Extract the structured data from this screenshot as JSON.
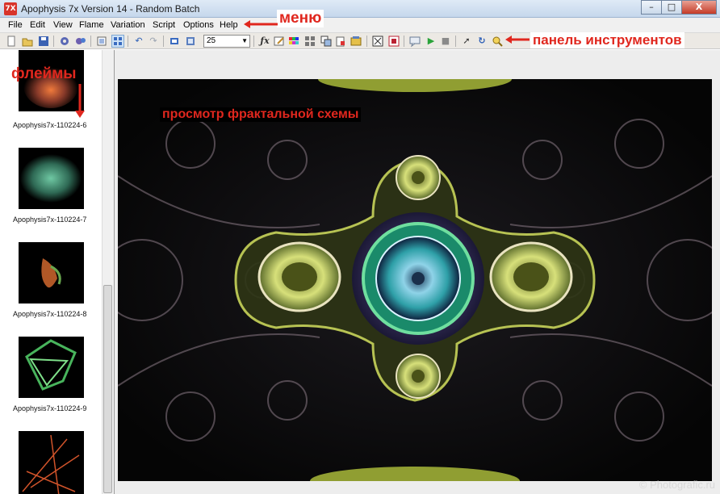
{
  "window": {
    "title": "Apophysis 7x Version 14 - Random Batch",
    "icon_text": "7X",
    "minimize": "–",
    "maximize": "□",
    "close": "X"
  },
  "menu": [
    "File",
    "Edit",
    "View",
    "Flame",
    "Variation",
    "Script",
    "Options",
    "Help"
  ],
  "toolbar": {
    "zoom_value": "25",
    "icons": [
      "new-icon",
      "open-icon",
      "save-icon",
      "gear-icon",
      "render-icon",
      "list-view-icon",
      "grid-view-icon",
      "undo-icon",
      "redo-icon",
      "copy-icon",
      "paste-icon",
      "fx-icon",
      "editor-icon",
      "gradient-icon",
      "mutate-icon",
      "adjust-icon",
      "favorites-icon",
      "image-icon",
      "fullscreen-icon",
      "film-icon",
      "message-icon",
      "play-icon",
      "stop-icon",
      "pointer-icon",
      "rotate-icon",
      "zoom-icon"
    ]
  },
  "flames": [
    {
      "label": "Apophysis7x-110224-6",
      "color": "#c9572e"
    },
    {
      "label": "Apophysis7x-110224-7",
      "color": "#3f8e70"
    },
    {
      "label": "Apophysis7x-110224-8",
      "color": "#c4622b"
    },
    {
      "label": "Apophysis7x-110224-9",
      "color": "#48b45c"
    },
    {
      "label": "",
      "color": "#d0532a"
    }
  ],
  "annotations": {
    "menu": "меню",
    "toolbar": "панель инструментов",
    "flames": "флеймы",
    "preview": "просмотр фрактальной схемы"
  },
  "colors": {
    "accent": "#e0271e"
  },
  "watermark": "© Photografic.ru"
}
